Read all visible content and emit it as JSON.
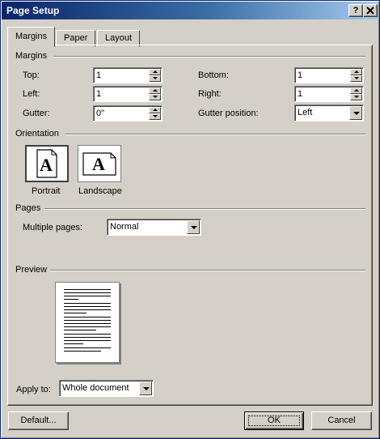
{
  "window": {
    "title": "Page Setup",
    "help_btn": "?",
    "close_btn": "X"
  },
  "tabs": [
    {
      "label": "Margins"
    },
    {
      "label": "Paper"
    },
    {
      "label": "Layout"
    }
  ],
  "margins": {
    "group_label": "Margins",
    "top": {
      "label": "Top:",
      "value": "1"
    },
    "bottom": {
      "label": "Bottom:",
      "value": "1"
    },
    "left": {
      "label": "Left:",
      "value": "1"
    },
    "right": {
      "label": "Right:",
      "value": "1"
    },
    "gutter": {
      "label": "Gutter:",
      "value": "0\""
    },
    "gutter_position": {
      "label": "Gutter position:",
      "value": "Left"
    }
  },
  "orientation": {
    "group_label": "Orientation",
    "portrait": {
      "label": "Portrait",
      "glyph": "A"
    },
    "landscape": {
      "label": "Landscape",
      "glyph": "A"
    },
    "selected": "portrait"
  },
  "pages": {
    "group_label": "Pages",
    "multiple_pages_label": "Multiple pages:",
    "multiple_pages_value": "Normal"
  },
  "preview": {
    "group_label": "Preview",
    "apply_to_label": "Apply to:",
    "apply_to_value": "Whole document"
  },
  "buttons": {
    "default": "Default...",
    "ok": "OK",
    "cancel": "Cancel"
  }
}
